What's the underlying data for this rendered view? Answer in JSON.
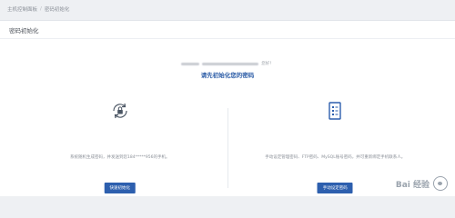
{
  "breadcrumb": {
    "items": [
      "主机控制面板",
      "密码初始化"
    ],
    "separator": "/"
  },
  "card": {
    "title": "密码初始化",
    "account_suffix": "您好！",
    "headline": "请先初始化您的密码"
  },
  "options": [
    {
      "icon": "lock-refresh-icon",
      "description": "系统随机生成密码，并发送到您184*****956的手机。",
      "button_label": "快速初始化"
    },
    {
      "icon": "document-form-icon",
      "description": "手动设定管理密码、FTP密码、MySQL账号密码，并可重新绑定手机联系人。",
      "button_label": "手动设定密码"
    }
  ],
  "watermark": {
    "text": "Bai 经验"
  },
  "colors": {
    "accent": "#2d5fae",
    "headline": "#2f5fa8"
  }
}
